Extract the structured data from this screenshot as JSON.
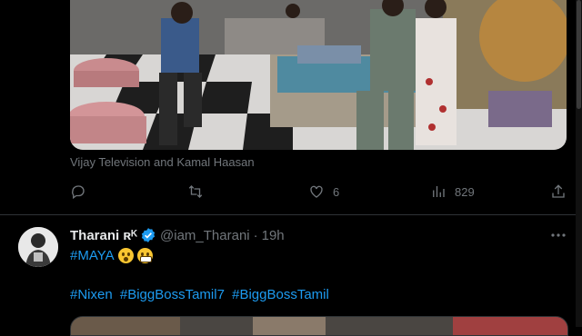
{
  "tweet1": {
    "caption": "Vijay Television and Kamal Haasan",
    "actions": {
      "reply_count": "",
      "retweet_count": "",
      "like_count": "6",
      "view_count": "829"
    }
  },
  "tweet2": {
    "display_name": "Tharani ʀᴷ",
    "handle": "@iam_Tharani",
    "separator": "·",
    "time": "19h",
    "line1_hashtag": "#MAYA",
    "line2_hashtags": [
      "#Nixen",
      "#BiggBossTamil7",
      "#BiggBossTamil"
    ]
  },
  "colors": {
    "background": "#000000",
    "text": "#e7e9ea",
    "muted": "#71767b",
    "link": "#1d9bf0",
    "divider": "#2f3336"
  },
  "icons": [
    "reply-icon",
    "retweet-icon",
    "like-icon",
    "views-icon",
    "share-icon",
    "verified-badge-icon",
    "more-icon"
  ]
}
